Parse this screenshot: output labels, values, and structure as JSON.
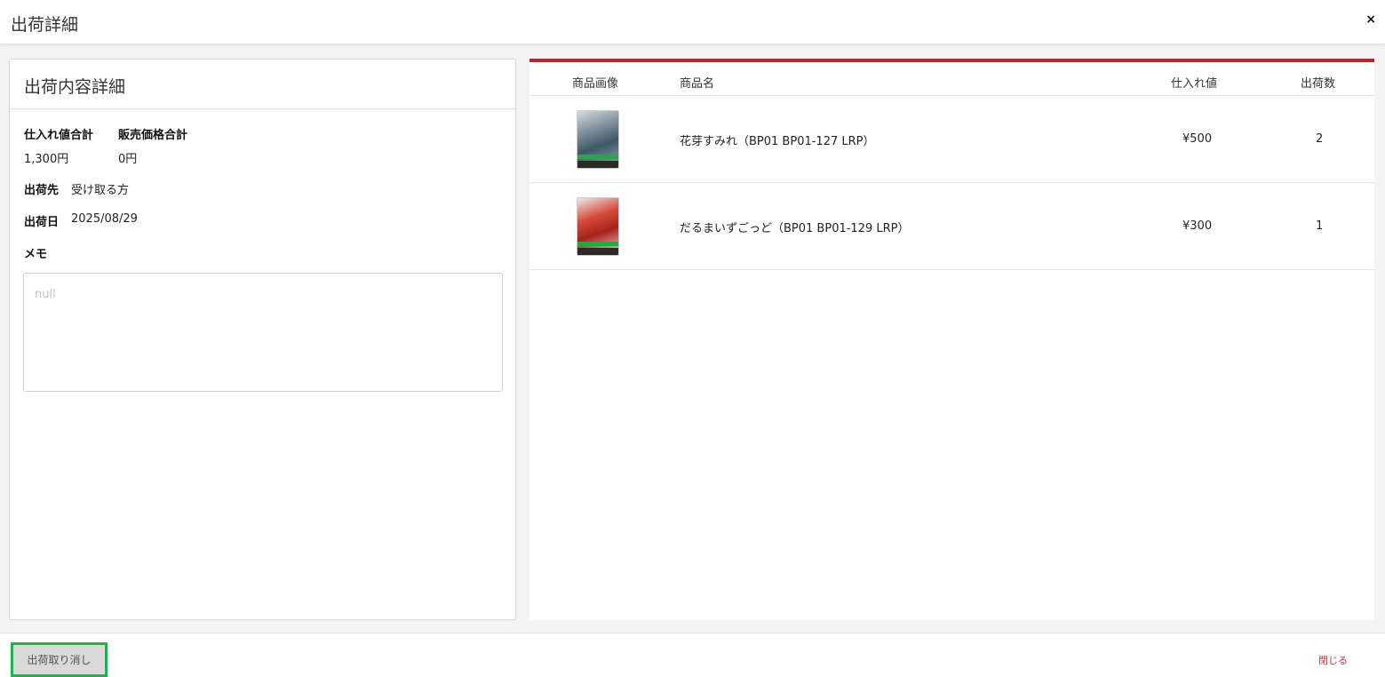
{
  "modal": {
    "title": "出荷詳細",
    "close_symbol": "×"
  },
  "left": {
    "header": "出荷内容詳細",
    "purchase_total_label": "仕入れ値合計",
    "purchase_total_value": "1,300円",
    "sales_total_label": "販売価格合計",
    "sales_total_value": "0円",
    "destination_label": "出荷先",
    "destination_value": "受け取る方",
    "date_label": "出荷日",
    "date_value": "2025/08/29",
    "memo_label": "メモ",
    "memo_placeholder": "null"
  },
  "table": {
    "headers": {
      "image": "商品画像",
      "name": "商品名",
      "price": "仕入れ値",
      "qty": "出荷数"
    },
    "accent_color": "#b8252f",
    "rows": [
      {
        "name": "花芽すみれ（BP01 BP01-127 LRP）",
        "price": "¥500",
        "qty": "2"
      },
      {
        "name": "だるまいずごっど（BP01 BP01-129 LRP）",
        "price": "¥300",
        "qty": "1"
      }
    ]
  },
  "footer": {
    "cancel_label": "出荷取り消し",
    "close_label": "閉じる"
  }
}
